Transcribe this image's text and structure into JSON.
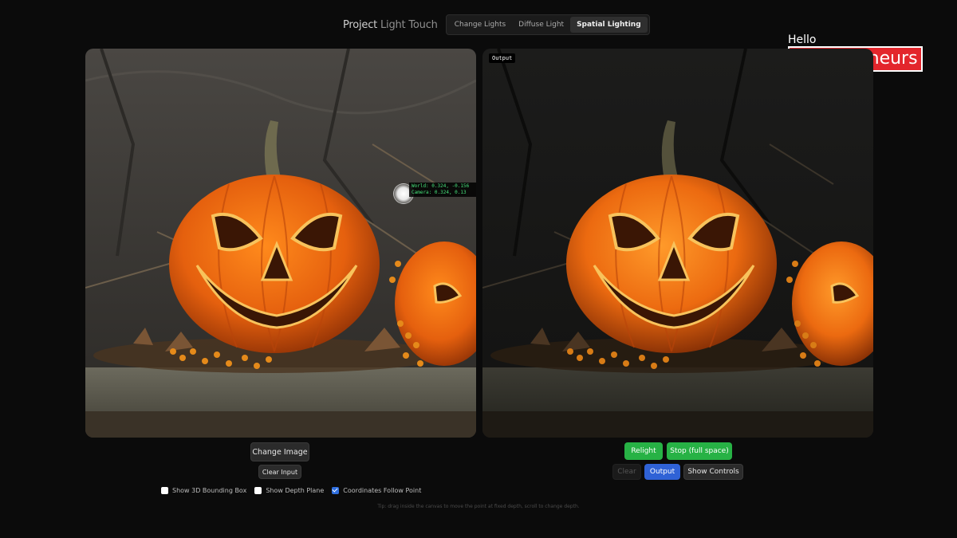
{
  "header": {
    "title_main": "Project ",
    "title_accent": "Light Touch",
    "tabs": [
      {
        "label": "Change Lights",
        "active": false
      },
      {
        "label": "Diffuse Light",
        "active": false
      },
      {
        "label": "Spatial Lighting",
        "active": true
      }
    ]
  },
  "logo": {
    "line1": "Hello",
    "line2": "Entrepreneurs",
    "brand_color": "#e3262c"
  },
  "input_panel": {
    "coords": {
      "world": "World: 0.324, -0.156",
      "camera": "Camera: 0.324, 0.13"
    },
    "change_image_label": "Change Image",
    "clear_input_label": "Clear Input",
    "checkboxes": [
      {
        "label": "Show 3D Bounding Box",
        "checked": false
      },
      {
        "label": "Show Depth Plane",
        "checked": false
      },
      {
        "label": "Coordinates Follow Point",
        "checked": true
      }
    ]
  },
  "output_panel": {
    "label": "Output",
    "relight_label": "Relight",
    "stop_label": "Stop (full space)",
    "clear_label": "Clear",
    "output_label": "Output",
    "show_controls_label": "Show Controls"
  },
  "tip": "Tip: drag inside the canvas to move the point at fixed depth, scroll to change depth.",
  "colors": {
    "green": "#27b245",
    "blue": "#2f62d6",
    "coords_text": "#46e07a"
  }
}
